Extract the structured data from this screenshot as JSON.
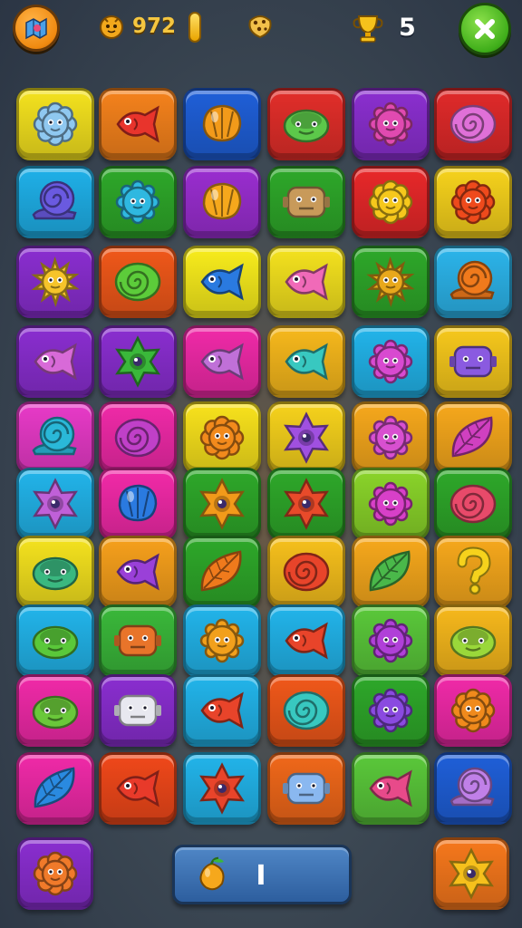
{
  "hud": {
    "coins": "972",
    "level": "5",
    "icons": {
      "menu": "map-icon",
      "coin": "coin-icon",
      "energy": "gold-bar-icon",
      "bonus": "cookie-icon",
      "trophy": "trophy-icon",
      "close": "close-icon"
    }
  },
  "board": {
    "rows": 10,
    "cols": 6,
    "tiles": [
      [
        {
          "bg": "#f4e21e",
          "fg": "#8fc8f0",
          "shape": "flower"
        },
        {
          "bg": "#f5821c",
          "fg": "#e8342c",
          "shape": "fish"
        },
        {
          "bg": "#1f5fd8",
          "fg": "#f29a1a",
          "shape": "shell"
        },
        {
          "bg": "#e22e2a",
          "fg": "#5cc84a",
          "shape": "turtle"
        },
        {
          "bg": "#8b2fd0",
          "fg": "#e04ab0",
          "shape": "gear"
        },
        {
          "bg": "#e02a2a",
          "fg": "#e070d8",
          "shape": "swirl"
        }
      ],
      [
        {
          "bg": "#1fb0e8",
          "fg": "#6a5ae0",
          "shape": "snail"
        },
        {
          "bg": "#2ea82a",
          "fg": "#2fb8e0",
          "shape": "gear"
        },
        {
          "bg": "#9a2ed0",
          "fg": "#f5a81c",
          "shape": "shell"
        },
        {
          "bg": "#2ea82a",
          "fg": "#c89a5a",
          "shape": "robot"
        },
        {
          "bg": "#e8282a",
          "fg": "#f6c81c",
          "shape": "flower"
        },
        {
          "bg": "#f6d21c",
          "fg": "#ee4a1c",
          "shape": "flower"
        }
      ],
      [
        {
          "bg": "#8a2ed0",
          "fg": "#f6c42a",
          "shape": "sun"
        },
        {
          "bg": "#f0581a",
          "fg": "#5ccc3a",
          "shape": "swirl"
        },
        {
          "bg": "#f8ec1c",
          "fg": "#2a7ae0",
          "shape": "fish"
        },
        {
          "bg": "#f4e21e",
          "fg": "#f06ab8",
          "shape": "fish"
        },
        {
          "bg": "#2ea82a",
          "fg": "#e8a81c",
          "shape": "sun"
        },
        {
          "bg": "#2cb4ea",
          "fg": "#f07a1c",
          "shape": "snail"
        }
      ],
      [
        {
          "bg": "#8a2ed0",
          "fg": "#d86ad8",
          "shape": "fish"
        },
        {
          "bg": "#8a2ed0",
          "fg": "#3ab83a",
          "shape": "star"
        },
        {
          "bg": "#f02aa8",
          "fg": "#c070d8",
          "shape": "fish"
        },
        {
          "bg": "#f6b81c",
          "fg": "#38c8c0",
          "shape": "fish"
        },
        {
          "bg": "#22b4ea",
          "fg": "#d84ad0",
          "shape": "gear"
        },
        {
          "bg": "#f6c81c",
          "fg": "#8a5ae0",
          "shape": "robot"
        }
      ],
      [
        {
          "bg": "#e83ac8",
          "fg": "#2ab8d8",
          "shape": "snail"
        },
        {
          "bg": "#f02aa8",
          "fg": "#c040c8",
          "shape": "swirl"
        },
        {
          "bg": "#f8e21c",
          "fg": "#f28a1c",
          "shape": "flower"
        },
        {
          "bg": "#f6d21c",
          "fg": "#a050e0",
          "shape": "star"
        },
        {
          "bg": "#f6a81c",
          "fg": "#d850d0",
          "shape": "gear"
        },
        {
          "bg": "#f6a81c",
          "fg": "#d040c0",
          "shape": "leaf"
        }
      ],
      [
        {
          "bg": "#22b4ea",
          "fg": "#c060d8",
          "shape": "star"
        },
        {
          "bg": "#f22aa8",
          "fg": "#2a7ae0",
          "shape": "shell"
        },
        {
          "bg": "#2ea82a",
          "fg": "#f29a1a",
          "shape": "star"
        },
        {
          "bg": "#2ea82a",
          "fg": "#e84a2a",
          "shape": "star"
        },
        {
          "bg": "#8ad42a",
          "fg": "#d840c8",
          "shape": "gear"
        },
        {
          "bg": "#2ea82a",
          "fg": "#e84a6a",
          "shape": "swirl"
        }
      ],
      [
        {
          "bg": "#f4e21e",
          "fg": "#3ab880",
          "shape": "turtle"
        },
        {
          "bg": "#f6a01c",
          "fg": "#9a40d8",
          "shape": "fish"
        },
        {
          "bg": "#2ea82a",
          "fg": "#f07a1c",
          "shape": "leaf"
        },
        {
          "bg": "#f6c01c",
          "fg": "#e8442a",
          "shape": "swirl"
        },
        {
          "bg": "#f6a81c",
          "fg": "#4ab84a",
          "shape": "leaf"
        },
        {
          "bg": "#f6a81c",
          "fg": "#f6d21c",
          "shape": "question"
        }
      ],
      [
        {
          "bg": "#22b4ea",
          "fg": "#5ac83a",
          "shape": "turtle"
        },
        {
          "bg": "#3ab83a",
          "fg": "#e8742a",
          "shape": "robot"
        },
        {
          "bg": "#22b4ea",
          "fg": "#f2a01c",
          "shape": "gear"
        },
        {
          "bg": "#22b4ea",
          "fg": "#e8442a",
          "shape": "fish"
        },
        {
          "bg": "#5ac83a",
          "fg": "#b040d8",
          "shape": "gear"
        },
        {
          "bg": "#f6b81c",
          "fg": "#9ad83a",
          "shape": "turtle"
        }
      ],
      [
        {
          "bg": "#f02aa8",
          "fg": "#6ac83a",
          "shape": "turtle"
        },
        {
          "bg": "#8a2ed0",
          "fg": "#e8e8f0",
          "shape": "robot"
        },
        {
          "bg": "#22b4ea",
          "fg": "#e8442a",
          "shape": "fish"
        },
        {
          "bg": "#f0581a",
          "fg": "#38c8c0",
          "shape": "swirl"
        },
        {
          "bg": "#2ea82a",
          "fg": "#8a4ae0",
          "shape": "gear"
        },
        {
          "bg": "#f02aa8",
          "fg": "#f08a1c",
          "shape": "flower"
        }
      ],
      [
        {
          "bg": "#f02aa8",
          "fg": "#2a8ae0",
          "shape": "leaf"
        },
        {
          "bg": "#f0481a",
          "fg": "#e83a2a",
          "shape": "fish"
        },
        {
          "bg": "#22b4ea",
          "fg": "#e8442a",
          "shape": "star"
        },
        {
          "bg": "#f0681a",
          "fg": "#8ab8f0",
          "shape": "robot"
        },
        {
          "bg": "#5ac83a",
          "fg": "#e84a8a",
          "shape": "fish"
        },
        {
          "bg": "#1f5fd8",
          "fg": "#c080e8",
          "shape": "snail"
        }
      ]
    ]
  },
  "footer": {
    "left_tile": {
      "bg": "#8a2ed0",
      "fg": "#f07a2a",
      "shape": "flower"
    },
    "right_tile": {
      "bg": "#f6781c",
      "fg": "#f6c01c",
      "shape": "star"
    },
    "status_icon": "orange-fruit-icon",
    "status_value": "I"
  }
}
